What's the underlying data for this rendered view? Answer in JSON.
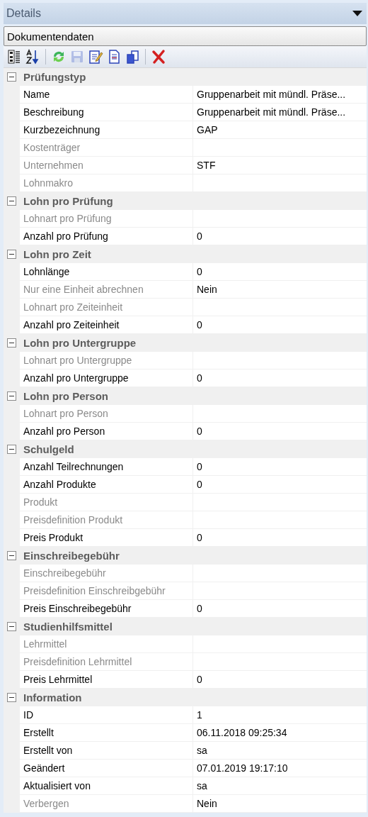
{
  "panel": {
    "title": "Details",
    "dropdown": "Dokumentendaten"
  },
  "toolbar": [
    {
      "kind": "categorized",
      "disabled": false
    },
    {
      "kind": "sort",
      "disabled": false
    },
    {
      "kind": "separator"
    },
    {
      "kind": "refresh",
      "disabled": false
    },
    {
      "kind": "save",
      "disabled": true
    },
    {
      "kind": "edit",
      "disabled": false
    },
    {
      "kind": "document",
      "disabled": false
    },
    {
      "kind": "copy",
      "disabled": false
    },
    {
      "kind": "separator"
    },
    {
      "kind": "delete",
      "disabled": false
    }
  ],
  "categories": [
    {
      "name": "Prüfungstyp",
      "expanded": true,
      "properties": [
        {
          "label": "Name",
          "value": "Gruppenarbeit mit mündl. Präse...",
          "disabled": false
        },
        {
          "label": "Beschreibung",
          "value": "Gruppenarbeit mit mündl. Präse...",
          "disabled": false
        },
        {
          "label": "Kurzbezeichnung",
          "value": "GAP",
          "disabled": false
        },
        {
          "label": "Kostenträger",
          "disabled": true
        },
        {
          "label": "Unternehmen",
          "value": "STF",
          "disabled": true
        },
        {
          "label": "Lohnmakro",
          "disabled": true
        }
      ]
    },
    {
      "name": "Lohn pro Prüfung",
      "expanded": true,
      "properties": [
        {
          "label": "Lohnart pro Prüfung",
          "disabled": true
        },
        {
          "label": "Anzahl pro Prüfung",
          "value": "0",
          "disabled": false
        }
      ]
    },
    {
      "name": "Lohn pro Zeit",
      "expanded": true,
      "properties": [
        {
          "label": "Lohnlänge",
          "value": "0",
          "disabled": false
        },
        {
          "label": "Nur eine Einheit abrechnen",
          "value": "Nein",
          "disabled": true
        },
        {
          "label": "Lohnart pro Zeiteinheit",
          "disabled": true
        },
        {
          "label": "Anzahl pro Zeiteinheit",
          "value": "0",
          "disabled": false
        }
      ]
    },
    {
      "name": "Lohn pro Untergruppe",
      "expanded": true,
      "properties": [
        {
          "label": "Lohnart pro Untergruppe",
          "disabled": true
        },
        {
          "label": "Anzahl pro Untergruppe",
          "value": "0",
          "disabled": false
        }
      ]
    },
    {
      "name": "Lohn pro Person",
      "expanded": true,
      "properties": [
        {
          "label": "Lohnart pro Person",
          "disabled": true
        },
        {
          "label": "Anzahl pro Person",
          "value": "0",
          "disabled": false
        }
      ]
    },
    {
      "name": "Schulgeld",
      "expanded": true,
      "properties": [
        {
          "label": "Anzahl Teilrechnungen",
          "value": "0",
          "disabled": false
        },
        {
          "label": "Anzahl Produkte",
          "value": "0",
          "disabled": false
        },
        {
          "label": "Produkt",
          "disabled": true
        },
        {
          "label": "Preisdefinition Produkt",
          "disabled": true
        },
        {
          "label": "Preis Produkt",
          "value": "0",
          "disabled": false
        }
      ]
    },
    {
      "name": "Einschreibegebühr",
      "expanded": true,
      "properties": [
        {
          "label": "Einschreibegebühr",
          "disabled": true
        },
        {
          "label": "Preisdefinition Einschreibgebühr",
          "disabled": true
        },
        {
          "label": "Preis Einschreibegebühr",
          "value": "0",
          "disabled": false
        }
      ]
    },
    {
      "name": "Studienhilfsmittel",
      "expanded": true,
      "properties": [
        {
          "label": "Lehrmittel",
          "disabled": true
        },
        {
          "label": "Preisdefinition Lehrmittel",
          "disabled": true
        },
        {
          "label": "Preis Lehrmittel",
          "value": "0",
          "disabled": false
        }
      ]
    },
    {
      "name": "Information",
      "expanded": true,
      "properties": [
        {
          "label": "ID",
          "value": "1",
          "disabled": false
        },
        {
          "label": "Erstellt",
          "value": "06.11.2018 09:25:34",
          "disabled": false
        },
        {
          "label": "Erstellt von",
          "value": "sa",
          "disabled": false
        },
        {
          "label": "Geändert",
          "value": "07.01.2019 19:17:10",
          "disabled": false
        },
        {
          "label": "Aktualisiert von",
          "value": "sa",
          "disabled": false
        },
        {
          "label": "Verbergen",
          "value": "Nein",
          "disabled": true
        }
      ]
    }
  ]
}
